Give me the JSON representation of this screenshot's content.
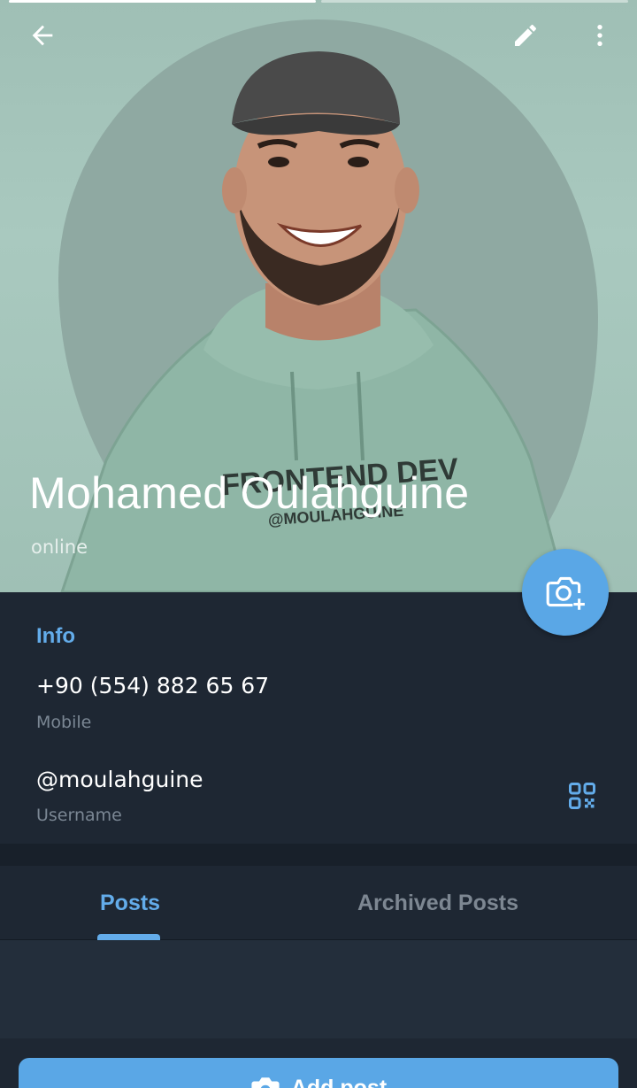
{
  "story": {
    "segments": 2,
    "active": 1
  },
  "header": {
    "name": "Mohamed Oulahguine",
    "status": "online",
    "hoodie_print": "FRONTEND DEV",
    "hoodie_handle": "@MOULAHGUINE"
  },
  "toolbar": {
    "back_icon": "arrow-left-icon",
    "edit_icon": "pencil-icon",
    "more_icon": "more-vertical-icon"
  },
  "fab": {
    "icon": "camera-add-icon"
  },
  "info": {
    "title": "Info",
    "phone": "+90 (554) 882 65 67",
    "phone_label": "Mobile",
    "username": "@moulahguine",
    "username_label": "Username",
    "qr_icon": "qr-code-icon"
  },
  "tabs": [
    {
      "label": "Posts",
      "active": true
    },
    {
      "label": "Archived Posts",
      "active": false
    }
  ],
  "add_post": {
    "label": "Add post",
    "icon": "camera-icon"
  },
  "colors": {
    "accent": "#5aa7e6",
    "accent_text": "#63acea",
    "background": "#1e2733",
    "photo_bg": "#a9c9bf"
  }
}
